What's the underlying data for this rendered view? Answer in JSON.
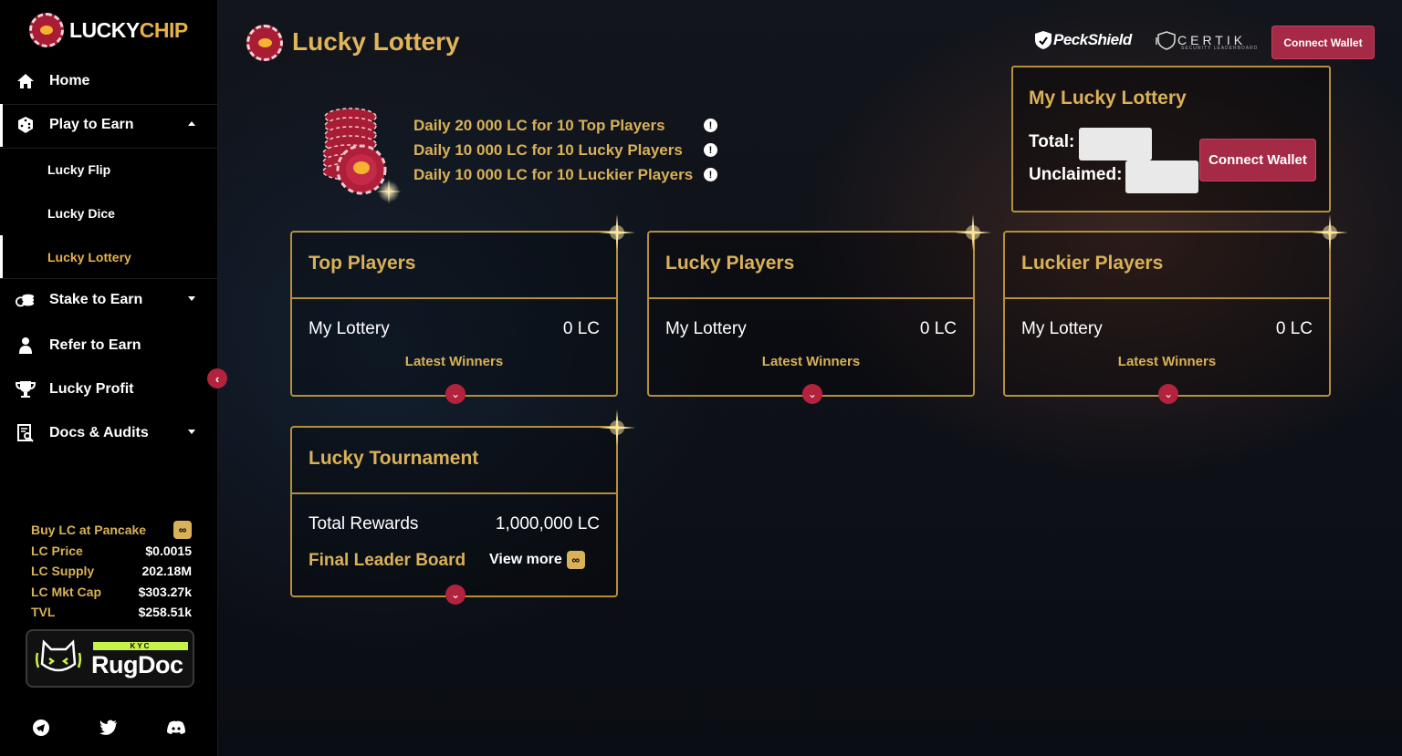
{
  "app": {
    "logo_part1": "LUCKY",
    "logo_part2": "CHIP"
  },
  "sidebar": {
    "items": [
      {
        "label": "Home",
        "icon": "home-icon"
      },
      {
        "label": "Play to Earn",
        "icon": "dice-icon",
        "expanded": true
      },
      {
        "label": "Stake to Earn",
        "icon": "coins-icon"
      },
      {
        "label": "Refer to Earn",
        "icon": "user-icon"
      },
      {
        "label": "Lucky Profit",
        "icon": "trophy-icon"
      },
      {
        "label": "Docs & Audits",
        "icon": "document-search-icon"
      }
    ],
    "subitems": [
      {
        "label": "Lucky Flip"
      },
      {
        "label": "Lucky Dice"
      },
      {
        "label": "Lucky Lottery",
        "active": true
      }
    ],
    "stats": {
      "buy_label": "Buy LC at Pancake",
      "rows": [
        {
          "label": "LC Price",
          "value": "$0.0015"
        },
        {
          "label": "LC Supply",
          "value": "202.18M"
        },
        {
          "label": "LC Mkt Cap",
          "value": "$303.27k"
        },
        {
          "label": "TVL",
          "value": "$258.51k"
        }
      ]
    },
    "rugdoc": {
      "kyc": "KYC",
      "name": "RugDoc"
    },
    "social": [
      "telegram-icon",
      "twitter-icon",
      "discord-icon"
    ]
  },
  "header": {
    "title": "Lucky Lottery",
    "peckshield": "PeckShield",
    "certik": "CERTIK",
    "certik_sub": "SECURITY LEADERBOARD",
    "connect_label": "Connect Wallet"
  },
  "promo": {
    "lines": [
      "Daily 20 000 LC for 10 Top Players",
      "Daily 10 000 LC for 10 Lucky Players",
      "Daily 10 000 LC for 10 Luckier Players"
    ]
  },
  "my_lottery": {
    "title": "My Lucky Lottery",
    "total_label": "Total:",
    "unclaimed_label": "Unclaimed:",
    "connect_label": "Connect Wallet"
  },
  "cards": [
    {
      "title": "Top Players",
      "row_label": "My Lottery",
      "row_value": "0 LC",
      "footer": "Latest Winners"
    },
    {
      "title": "Lucky Players",
      "row_label": "My Lottery",
      "row_value": "0 LC",
      "footer": "Latest Winners"
    },
    {
      "title": "Luckier Players",
      "row_label": "My Lottery",
      "row_value": "0 LC",
      "footer": "Latest Winners"
    }
  ],
  "tournament": {
    "title": "Lucky Tournament",
    "rewards_label": "Total Rewards",
    "rewards_value": "1,000,000 LC",
    "board_label": "Final Leader Board",
    "view_more": "View more"
  },
  "colors": {
    "gold": "#d9b158",
    "accent_red": "#a52a46",
    "background": "#0b0d14"
  }
}
